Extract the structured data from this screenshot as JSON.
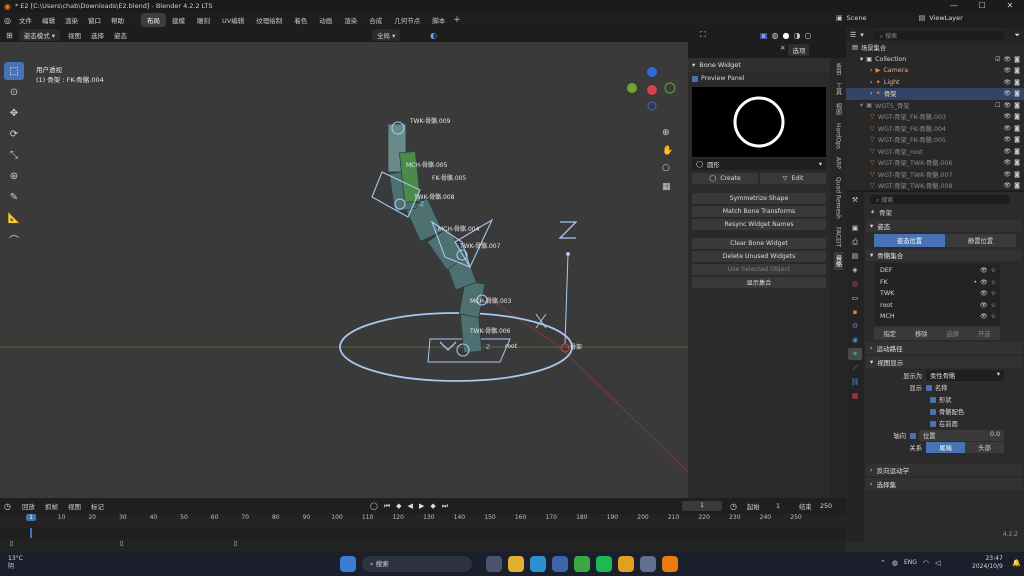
{
  "window": {
    "title": "* E2 [C:\\Users\\chab\\Downloads\\E2.blend] - Blender 4.2.2 LTS",
    "controls": [
      "—",
      "☐",
      "✕"
    ]
  },
  "topbar": {
    "menus": [
      "文件",
      "编辑",
      "渲染",
      "窗口",
      "帮助"
    ],
    "workspaces": [
      "布局",
      "建模",
      "雕刻",
      "UV编辑",
      "纹理绘制",
      "着色",
      "动画",
      "渲染",
      "合成",
      "几何节点",
      "脚本"
    ],
    "active_workspace": "布局",
    "scene_label": "Scene",
    "viewlayer_label": "ViewLayer"
  },
  "viewport_header": {
    "mode": "姿态模式",
    "menus": [
      "视图",
      "选择",
      "姿态"
    ],
    "transform": "全局",
    "options_label": "选项"
  },
  "viewport": {
    "view_name": "用户透视",
    "object_info": "(1) 骨架 : FK-骨骼.004",
    "bone_labels": [
      "TWK-骨骼.009",
      "MCH-骨骼.005",
      "FK-骨骼.005",
      "TWK-骨骼.008",
      "MCH-骨骼.004",
      "TWK-骨骼.007",
      "MCH-骨骼.003",
      "TWK-骨骼.006",
      "root",
      "骨架",
      "Z",
      "Y",
      "X",
      "Z"
    ]
  },
  "npanel": {
    "title": "Bone Widget",
    "preview_label": "Preview Panel",
    "shape_name": "圆形",
    "create_label": "Create",
    "edit_label": "Edit",
    "buttons": [
      "Symmetrize Shape",
      "Match Bone Transforms",
      "Resync Widget Names",
      "Clear Bone Widget",
      "Delete Unused Widgets",
      "Use Selected Object"
    ],
    "show_collection": "显示集合",
    "tabs": [
      "条目",
      "工具",
      "视图",
      "HardOps",
      "ARP",
      "Quad Remesh",
      "FACEIT",
      "骨骼"
    ]
  },
  "outliner": {
    "search_placeholder": "搜索",
    "rows": [
      {
        "label": "场景集合",
        "indent": 0
      },
      {
        "label": "Collection",
        "indent": 1
      },
      {
        "label": "Camera",
        "indent": 2
      },
      {
        "label": "Light",
        "indent": 2
      },
      {
        "label": "骨架",
        "indent": 2
      },
      {
        "label": "WGTS_骨架",
        "indent": 1
      },
      {
        "label": "WGT-骨架_FK-骨骼.003",
        "indent": 2
      },
      {
        "label": "WGT-骨架_FK-骨骼.004",
        "indent": 2
      },
      {
        "label": "WGT-骨架_FK-骨骼.005",
        "indent": 2
      },
      {
        "label": "WGT-骨架_root",
        "indent": 2
      },
      {
        "label": "WGT-骨架_TWK-骨骼.006",
        "indent": 2
      },
      {
        "label": "WGT-骨架_TWK-骨骼.007",
        "indent": 2
      },
      {
        "label": "WGT-骨架_TWK-骨骼.008",
        "indent": 2
      }
    ]
  },
  "properties": {
    "search_placeholder": "搜索",
    "object_name": "骨架",
    "pose_section": "姿态",
    "pose_position": "姿态位置",
    "rest_position": "静置位置",
    "bone_collections_section": "骨骼集合",
    "bone_collections": [
      "DEF",
      "FK",
      "TWK",
      "root",
      "MCH"
    ],
    "assign": "指定",
    "remove": "移除",
    "select": "选择",
    "deselect": "开选",
    "motion_paths": "运动路径",
    "viewport_display": "视图显示",
    "display_as_label": "显示为",
    "display_as_value": "柔性骨骼",
    "show_label": "显示",
    "show_options": [
      "名称",
      "形状",
      "骨骼配色",
      "在前面"
    ],
    "axes_label": "轴向",
    "position_label": "位置",
    "position_value": "0.0",
    "relation_label": "关系",
    "tail": "尾端",
    "head": "头部",
    "inverse_kinematics": "反向运动学",
    "selection_sets": "选择集",
    "version": "4.2.2"
  },
  "timeline": {
    "menus": [
      "回放",
      "抓帧",
      "视图",
      "标记"
    ],
    "current_frame": "1",
    "start_label": "起始",
    "start_value": "1",
    "end_label": "结束",
    "end_value": "250",
    "ticks": [
      "1",
      "10",
      "20",
      "30",
      "40",
      "50",
      "60",
      "70",
      "80",
      "90",
      "100",
      "110",
      "120",
      "130",
      "140",
      "150",
      "160",
      "170",
      "180",
      "190",
      "200",
      "210",
      "220",
      "230",
      "240",
      "250"
    ]
  },
  "taskbar": {
    "weather_temp": "13°C",
    "weather_desc": "阴",
    "search_label": "搜索",
    "lang": "ENG",
    "time": "23:47",
    "date": "2024/10/9"
  }
}
